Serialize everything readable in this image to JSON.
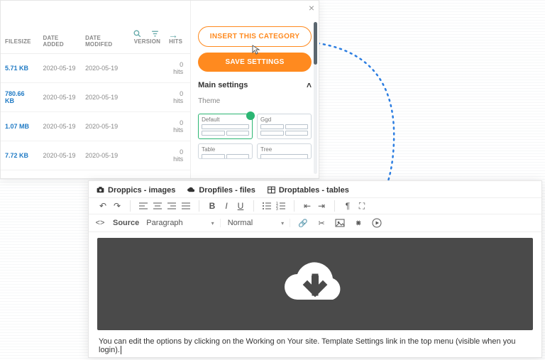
{
  "top": {
    "buttons": {
      "insert": "INSERT THIS CATEGORY",
      "save": "SAVE SETTINGS"
    },
    "table": {
      "headers": [
        "FILESIZE",
        "DATE ADDED",
        "DATE MODIFED",
        "VERSION",
        "HITS"
      ],
      "rows": [
        {
          "size": "5.71 KB",
          "added": "2020-05-19",
          "modified": "2020-05-19",
          "version": "",
          "hits": "0 hits"
        },
        {
          "size": "780.66 KB",
          "added": "2020-05-19",
          "modified": "2020-05-19",
          "version": "",
          "hits": "0 hits"
        },
        {
          "size": "1.07 MB",
          "added": "2020-05-19",
          "modified": "2020-05-19",
          "version": "",
          "hits": "0 hits"
        },
        {
          "size": "7.72 KB",
          "added": "2020-05-19",
          "modified": "2020-05-19",
          "version": "",
          "hits": "0 hits"
        }
      ]
    },
    "settings": {
      "section": "Main settings",
      "theme_label": "Theme",
      "themes": {
        "default": "Default",
        "ggd": "Ggd",
        "table": "Table",
        "tree": "Tree"
      }
    }
  },
  "editor": {
    "tabs": {
      "droppics": "Droppics - images",
      "dropfiles": "Dropfiles - files",
      "droptables": "Droptables - tables"
    },
    "source": "Source",
    "format": "Paragraph",
    "fontset": "Normal",
    "body_text": "You can edit the options by clicking on the Working on Your site. Template Settings link in the top menu (visible when you login)."
  },
  "colors": {
    "accent": "#ff8a1f",
    "link": "#1f7ac4",
    "ok": "#2bb673",
    "dot": "#2b7de1"
  }
}
